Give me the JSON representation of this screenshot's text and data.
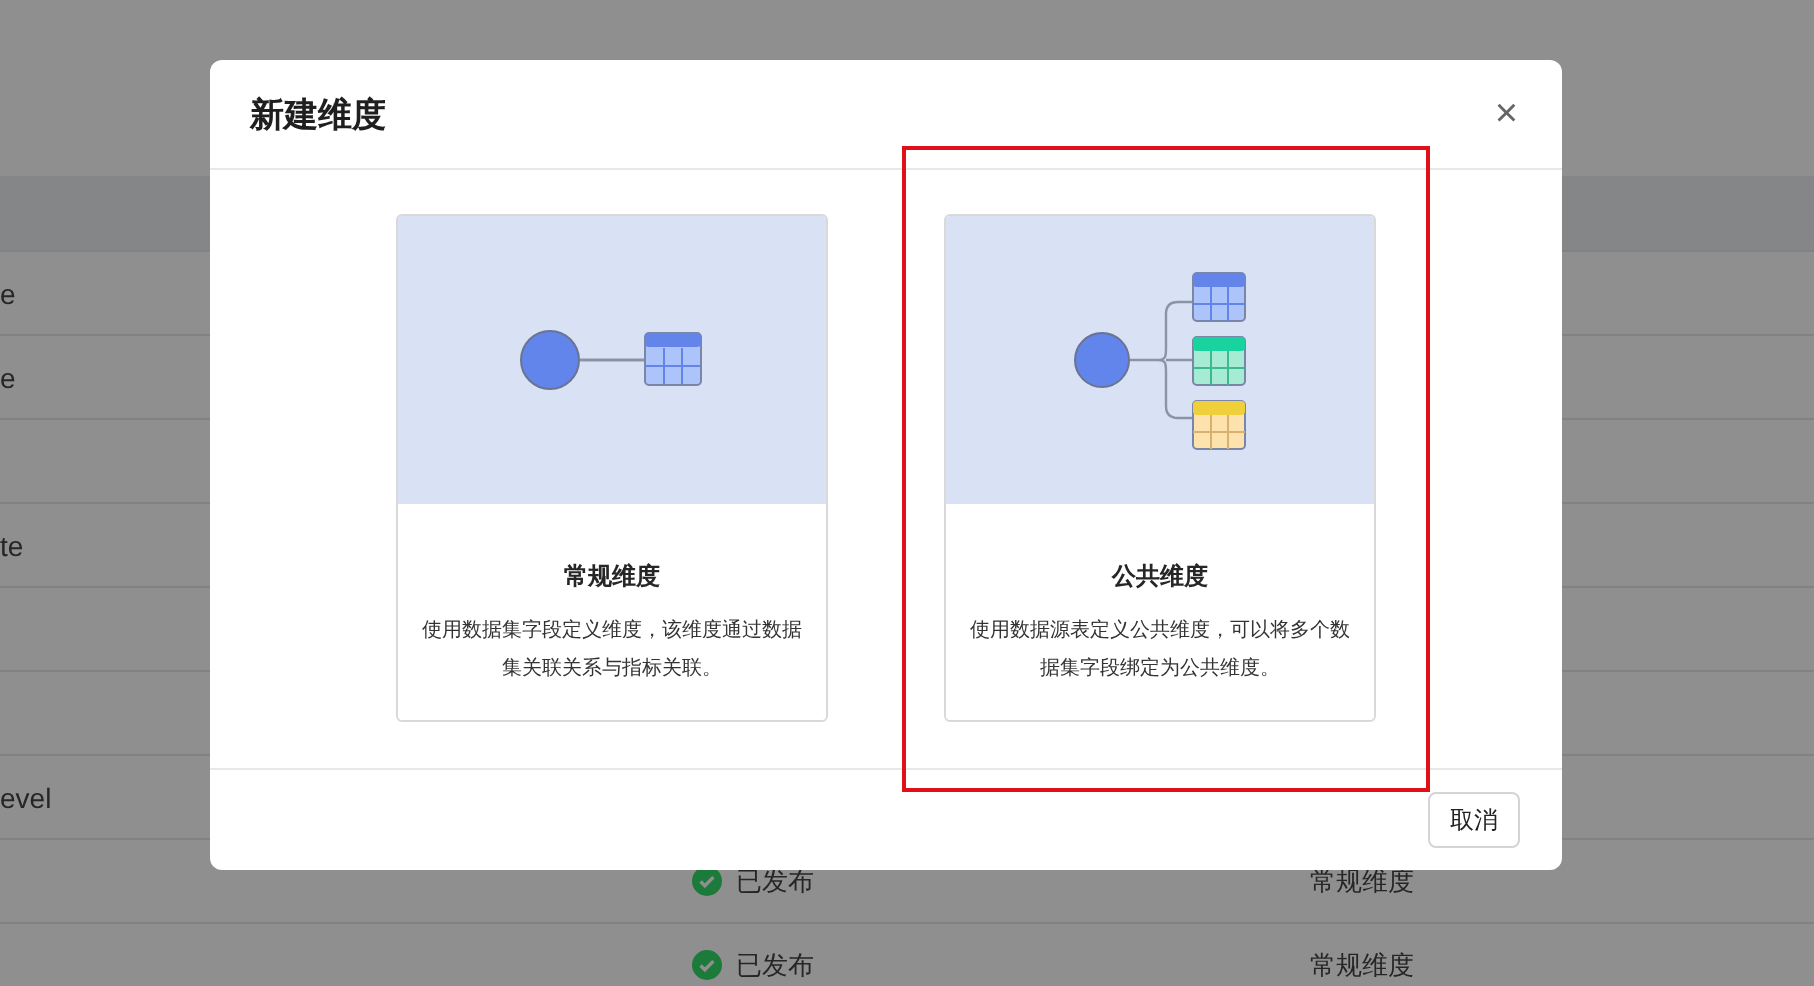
{
  "background_table": {
    "rows": [
      {
        "column_1": "e"
      },
      {
        "column_1": "e"
      },
      {},
      {
        "column_1": "te"
      },
      {},
      {},
      {
        "column_1": "evel"
      },
      {
        "status": "已发布",
        "type": "常规维度"
      },
      {
        "status": "已发布",
        "type": "常规维度"
      }
    ]
  },
  "dialog": {
    "title": "新建维度",
    "close": "×",
    "cards": [
      {
        "kind": "single",
        "title": "常规维度",
        "description": "使用数据集字段定义维度，该维度通过数据集关联关系与指标关联。"
      },
      {
        "kind": "multi",
        "title": "公共维度",
        "description": "使用数据源表定义公共维度，可以将多个数据集字段绑定为公共维度。"
      }
    ],
    "cancel_button": "取消"
  }
}
